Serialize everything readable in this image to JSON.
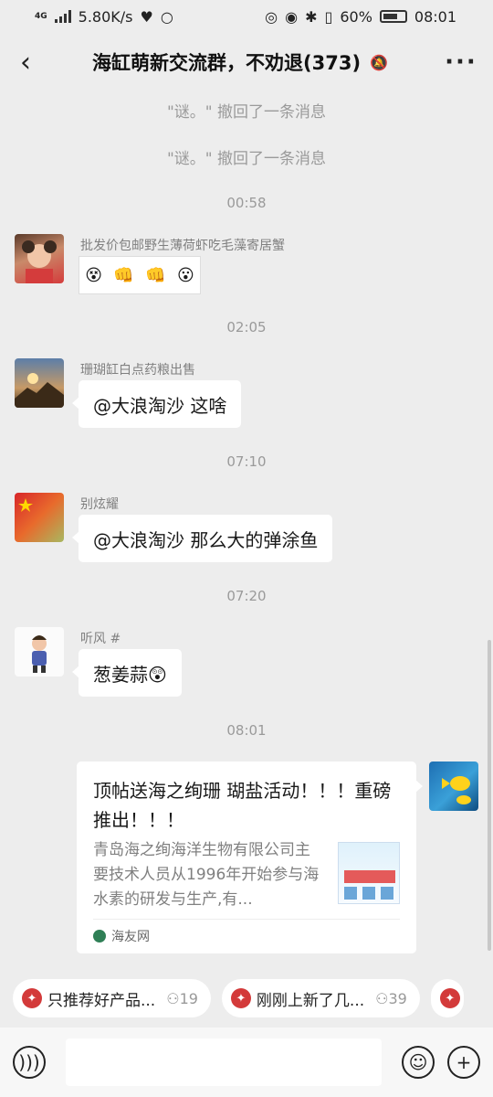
{
  "status_bar": {
    "network": "4G",
    "speed": "5.80K/s",
    "battery": "60%",
    "time": "08:01"
  },
  "header": {
    "back_icon": "chevron-left-icon",
    "title": "海缸萌新交流群，不劝退(373)",
    "mute_icon": "bell-off-icon",
    "more_label": "···"
  },
  "messages": {
    "recall_1": "\"谜。\" 撤回了一条消息",
    "recall_2": "\"谜。\" 撤回了一条消息",
    "time_1": "00:58",
    "msg_1": {
      "sender": "批发价包邮野生薄荷虾吃毛藻寄居蟹",
      "content_type": "sticker"
    },
    "time_2": "02:05",
    "msg_2": {
      "sender": "珊瑚缸白点药粮出售",
      "text": "@大浪淘沙  这啥"
    },
    "time_3": "07:10",
    "msg_3": {
      "sender": "别炫耀",
      "text": "@大浪淘沙  那么大的弹涂鱼"
    },
    "time_4": "07:20",
    "msg_4": {
      "sender": "听风 #",
      "text": "葱姜蒜😲"
    },
    "time_5": "08:01",
    "card": {
      "title": "顶帖送海之绚珊 瑚盐活动！！！重磅推出！！！",
      "description": "青岛海之绚海洋生物有限公司主要技术人员从1996年开始参与海水素的研发与生产,有...",
      "source": "海友网"
    }
  },
  "quick_chips": [
    {
      "label": "只推荐好产品...",
      "count": "19"
    },
    {
      "label": "刚刚上新了几...",
      "count": "39"
    }
  ],
  "input_bar": {
    "voice_icon": "voice-icon",
    "emoji_icon": "emoji-icon",
    "plus_icon": "plus-icon"
  }
}
